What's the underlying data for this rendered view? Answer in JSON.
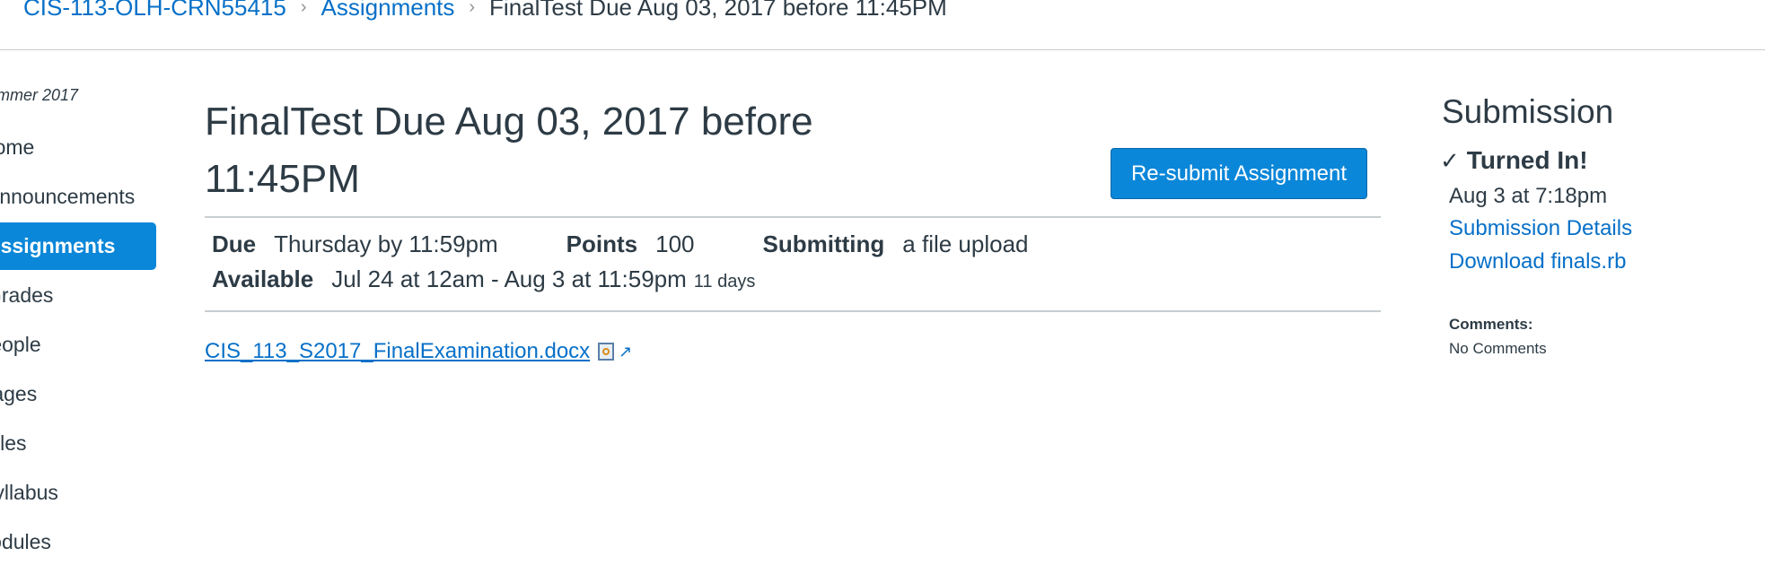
{
  "breadcrumb": {
    "course": "CIS-113-OLH-CRN55415",
    "section": "Assignments",
    "current": "FinalTest Due Aug 03, 2017 before 11:45PM"
  },
  "nav": {
    "term": "mmer 2017",
    "items": [
      {
        "label": "Home"
      },
      {
        "label": "Announcements"
      },
      {
        "label": "Assignments"
      },
      {
        "label": "Grades"
      },
      {
        "label": "People"
      },
      {
        "label": "Pages"
      },
      {
        "label": "Files"
      },
      {
        "label": "Syllabus"
      },
      {
        "label": "Modules"
      }
    ]
  },
  "assignment": {
    "title": "FinalTest Due Aug 03, 2017 before 11:45PM",
    "resubmit_label": "Re-submit Assignment",
    "due_label": "Due",
    "due_value": "Thursday by 11:59pm",
    "points_label": "Points",
    "points_value": "100",
    "submitting_label": "Submitting",
    "submitting_value": "a file upload",
    "available_label": "Available",
    "available_value": "Jul 24 at 12am - Aug 3 at 11:59pm",
    "available_duration": "11 days",
    "attachment": "CIS_113_S2017_FinalExamination.docx"
  },
  "submission": {
    "title": "Submission",
    "status": "Turned In!",
    "date": "Aug 3 at 7:18pm",
    "details_link": "Submission Details",
    "download_link": "Download finals.rb",
    "comments_label": "Comments:",
    "comments_value": "No Comments"
  },
  "colors": {
    "accent": "#0b87d9",
    "link": "#0770c8",
    "text": "#2d3b45"
  }
}
